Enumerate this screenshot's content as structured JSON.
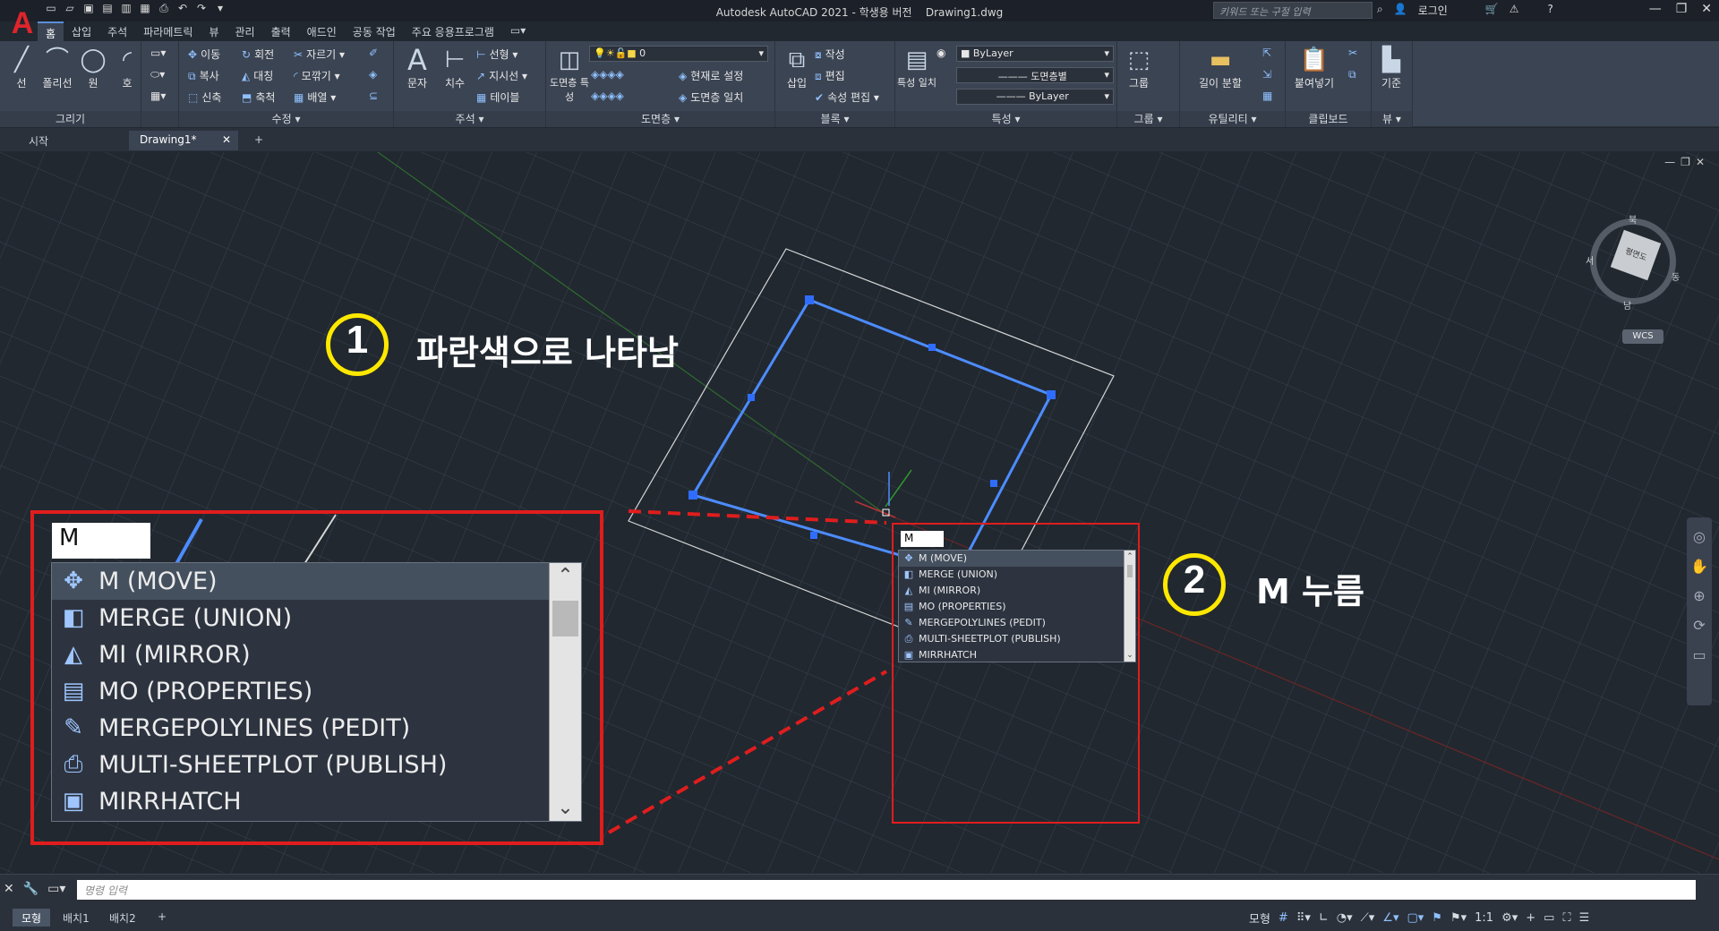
{
  "titlebar": {
    "app_title": "Autodesk AutoCAD 2021 - 학생용 버전",
    "file_name": "Drawing1.dwg",
    "search_placeholder": "키워드 또는 구절 입력",
    "login": "로그인"
  },
  "ribbon_tabs": [
    "홈",
    "삽입",
    "주석",
    "파라메트릭",
    "뷰",
    "관리",
    "출력",
    "애드인",
    "공동 작업",
    "주요 응용프로그램"
  ],
  "ribbon": {
    "draw": {
      "label": "그리기",
      "line": "선",
      "polyline": "폴리선",
      "circle": "원",
      "arc": "호"
    },
    "modify": {
      "label": "수정",
      "move": "이동",
      "rotate": "회전",
      "trim": "자르기",
      "copy": "복사",
      "mirror": "대칭",
      "fillet": "모깎기",
      "stretch": "신축",
      "scale": "축척",
      "array": "배열"
    },
    "annotation": {
      "label": "주석",
      "text": "문자",
      "dimension": "치수",
      "linear": "선형",
      "leader": "지시선",
      "table": "테이블"
    },
    "layers": {
      "label": "도면층",
      "layer_props": "도면층 특성",
      "current_layer": "0",
      "make_current": "현재로 설정",
      "match_layer": "도면층 일치"
    },
    "block": {
      "label": "블록",
      "insert": "삽입",
      "create": "작성",
      "edit": "편집",
      "edit_attributes": "속성 편집"
    },
    "properties": {
      "label": "특성",
      "match": "특성 일치",
      "color": "ByLayer",
      "linetype": "도면층별",
      "lineweight": "ByLayer"
    },
    "groups": {
      "label": "그룹",
      "group": "그룹"
    },
    "utilities": {
      "label": "유틸리티",
      "measure": "길이 분할"
    },
    "clipboard": {
      "label": "클립보드",
      "paste": "붙여넣기"
    },
    "view": {
      "label": "뷰",
      "base": "기준"
    }
  },
  "doc_tabs": [
    "시작",
    "Drawing1*"
  ],
  "viewcube": {
    "face": "평면도",
    "north": "북",
    "south": "남",
    "east": "동",
    "west": "서",
    "wcs": "WCS"
  },
  "annotations": {
    "step1_num": "1",
    "step1_text": "파란색으로 나타남",
    "step2_num": "2",
    "step2_text": "M 누름"
  },
  "autocomplete": {
    "input": "M",
    "items": [
      {
        "label": "M (MOVE)",
        "icon": "move-icon",
        "glyph": "✥"
      },
      {
        "label": "MERGE (UNION)",
        "icon": "union-icon",
        "glyph": "◧"
      },
      {
        "label": "MI (MIRROR)",
        "icon": "mirror-icon",
        "glyph": "◭"
      },
      {
        "label": "MO (PROPERTIES)",
        "icon": "properties-icon",
        "glyph": "▤"
      },
      {
        "label": "MERGEPOLYLINES (PEDIT)",
        "icon": "pedit-icon",
        "glyph": "✎"
      },
      {
        "label": "MULTI-SHEETPLOT (PUBLISH)",
        "icon": "publish-icon",
        "glyph": "⎙"
      },
      {
        "label": "MIRRHATCH",
        "icon": "mirrhatch-icon",
        "glyph": "▣"
      }
    ]
  },
  "command_line": {
    "placeholder": "명령 입력"
  },
  "layout_tabs": [
    "모형",
    "배치1",
    "배치2"
  ],
  "status": {
    "model_label": "모형",
    "scale": "1:1"
  },
  "colors": {
    "accent": "#5a8fd8",
    "selection_blue": "#4d8cff",
    "callout_yellow": "#ffe800",
    "highlight_red": "#e01d1d"
  }
}
